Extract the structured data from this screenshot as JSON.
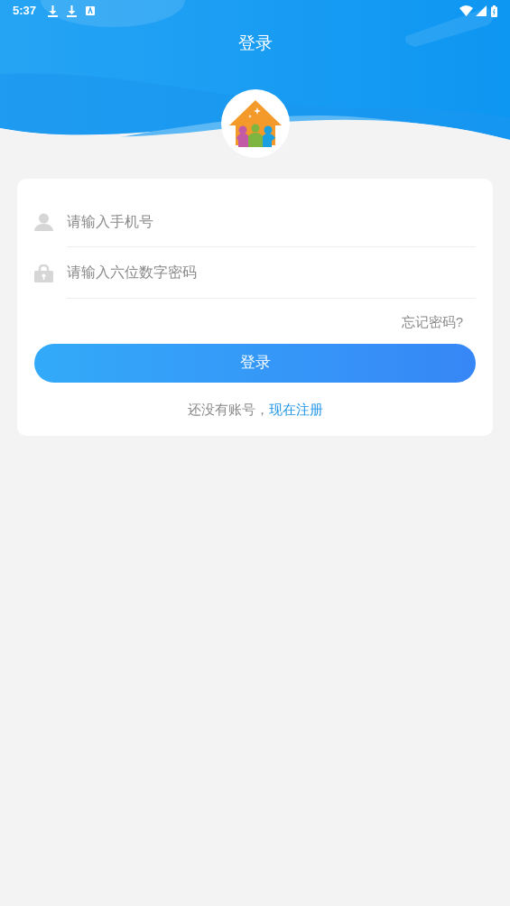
{
  "status_bar": {
    "time": "5:37"
  },
  "header": {
    "title": "登录"
  },
  "form": {
    "phone": {
      "placeholder": "请输入手机号"
    },
    "password": {
      "placeholder": "请输入六位数字密码"
    },
    "forgot_link": "忘记密码?",
    "login_button": "登录",
    "register_prompt": "还没有账号，",
    "register_link": "现在注册"
  }
}
